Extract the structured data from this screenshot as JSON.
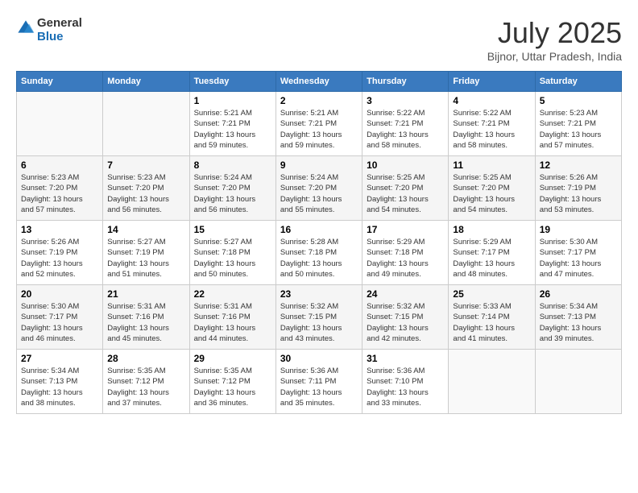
{
  "header": {
    "logo_line1": "General",
    "logo_line2": "Blue",
    "month": "July 2025",
    "location": "Bijnor, Uttar Pradesh, India"
  },
  "weekdays": [
    "Sunday",
    "Monday",
    "Tuesday",
    "Wednesday",
    "Thursday",
    "Friday",
    "Saturday"
  ],
  "weeks": [
    [
      {
        "day": "",
        "info": ""
      },
      {
        "day": "",
        "info": ""
      },
      {
        "day": "1",
        "info": "Sunrise: 5:21 AM\nSunset: 7:21 PM\nDaylight: 13 hours\nand 59 minutes."
      },
      {
        "day": "2",
        "info": "Sunrise: 5:21 AM\nSunset: 7:21 PM\nDaylight: 13 hours\nand 59 minutes."
      },
      {
        "day": "3",
        "info": "Sunrise: 5:22 AM\nSunset: 7:21 PM\nDaylight: 13 hours\nand 58 minutes."
      },
      {
        "day": "4",
        "info": "Sunrise: 5:22 AM\nSunset: 7:21 PM\nDaylight: 13 hours\nand 58 minutes."
      },
      {
        "day": "5",
        "info": "Sunrise: 5:23 AM\nSunset: 7:21 PM\nDaylight: 13 hours\nand 57 minutes."
      }
    ],
    [
      {
        "day": "6",
        "info": "Sunrise: 5:23 AM\nSunset: 7:20 PM\nDaylight: 13 hours\nand 57 minutes."
      },
      {
        "day": "7",
        "info": "Sunrise: 5:23 AM\nSunset: 7:20 PM\nDaylight: 13 hours\nand 56 minutes."
      },
      {
        "day": "8",
        "info": "Sunrise: 5:24 AM\nSunset: 7:20 PM\nDaylight: 13 hours\nand 56 minutes."
      },
      {
        "day": "9",
        "info": "Sunrise: 5:24 AM\nSunset: 7:20 PM\nDaylight: 13 hours\nand 55 minutes."
      },
      {
        "day": "10",
        "info": "Sunrise: 5:25 AM\nSunset: 7:20 PM\nDaylight: 13 hours\nand 54 minutes."
      },
      {
        "day": "11",
        "info": "Sunrise: 5:25 AM\nSunset: 7:20 PM\nDaylight: 13 hours\nand 54 minutes."
      },
      {
        "day": "12",
        "info": "Sunrise: 5:26 AM\nSunset: 7:19 PM\nDaylight: 13 hours\nand 53 minutes."
      }
    ],
    [
      {
        "day": "13",
        "info": "Sunrise: 5:26 AM\nSunset: 7:19 PM\nDaylight: 13 hours\nand 52 minutes."
      },
      {
        "day": "14",
        "info": "Sunrise: 5:27 AM\nSunset: 7:19 PM\nDaylight: 13 hours\nand 51 minutes."
      },
      {
        "day": "15",
        "info": "Sunrise: 5:27 AM\nSunset: 7:18 PM\nDaylight: 13 hours\nand 50 minutes."
      },
      {
        "day": "16",
        "info": "Sunrise: 5:28 AM\nSunset: 7:18 PM\nDaylight: 13 hours\nand 50 minutes."
      },
      {
        "day": "17",
        "info": "Sunrise: 5:29 AM\nSunset: 7:18 PM\nDaylight: 13 hours\nand 49 minutes."
      },
      {
        "day": "18",
        "info": "Sunrise: 5:29 AM\nSunset: 7:17 PM\nDaylight: 13 hours\nand 48 minutes."
      },
      {
        "day": "19",
        "info": "Sunrise: 5:30 AM\nSunset: 7:17 PM\nDaylight: 13 hours\nand 47 minutes."
      }
    ],
    [
      {
        "day": "20",
        "info": "Sunrise: 5:30 AM\nSunset: 7:17 PM\nDaylight: 13 hours\nand 46 minutes."
      },
      {
        "day": "21",
        "info": "Sunrise: 5:31 AM\nSunset: 7:16 PM\nDaylight: 13 hours\nand 45 minutes."
      },
      {
        "day": "22",
        "info": "Sunrise: 5:31 AM\nSunset: 7:16 PM\nDaylight: 13 hours\nand 44 minutes."
      },
      {
        "day": "23",
        "info": "Sunrise: 5:32 AM\nSunset: 7:15 PM\nDaylight: 13 hours\nand 43 minutes."
      },
      {
        "day": "24",
        "info": "Sunrise: 5:32 AM\nSunset: 7:15 PM\nDaylight: 13 hours\nand 42 minutes."
      },
      {
        "day": "25",
        "info": "Sunrise: 5:33 AM\nSunset: 7:14 PM\nDaylight: 13 hours\nand 41 minutes."
      },
      {
        "day": "26",
        "info": "Sunrise: 5:34 AM\nSunset: 7:13 PM\nDaylight: 13 hours\nand 39 minutes."
      }
    ],
    [
      {
        "day": "27",
        "info": "Sunrise: 5:34 AM\nSunset: 7:13 PM\nDaylight: 13 hours\nand 38 minutes."
      },
      {
        "day": "28",
        "info": "Sunrise: 5:35 AM\nSunset: 7:12 PM\nDaylight: 13 hours\nand 37 minutes."
      },
      {
        "day": "29",
        "info": "Sunrise: 5:35 AM\nSunset: 7:12 PM\nDaylight: 13 hours\nand 36 minutes."
      },
      {
        "day": "30",
        "info": "Sunrise: 5:36 AM\nSunset: 7:11 PM\nDaylight: 13 hours\nand 35 minutes."
      },
      {
        "day": "31",
        "info": "Sunrise: 5:36 AM\nSunset: 7:10 PM\nDaylight: 13 hours\nand 33 minutes."
      },
      {
        "day": "",
        "info": ""
      },
      {
        "day": "",
        "info": ""
      }
    ]
  ]
}
